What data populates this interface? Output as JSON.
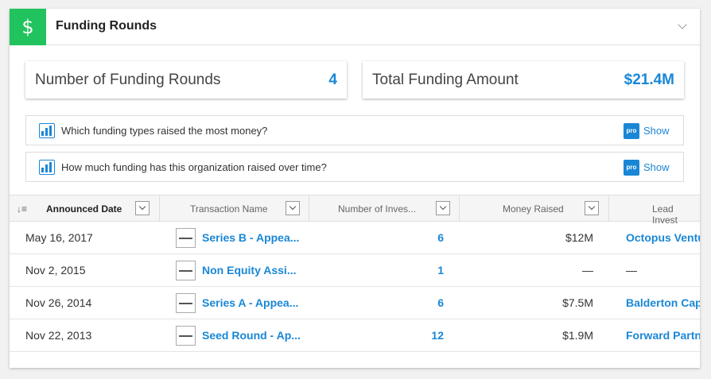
{
  "header": {
    "icon": "dollar-icon",
    "icon_glyph": "$",
    "title": "Funding Rounds"
  },
  "stats": {
    "rounds_label": "Number of Funding Rounds",
    "rounds_value": "4",
    "total_label": "Total Funding Amount",
    "total_value": "$21.4M"
  },
  "questions": [
    {
      "text": "Which funding types raised the most money?",
      "badge": "pro",
      "action": "Show"
    },
    {
      "text": "How much funding has this organization raised over time?",
      "badge": "pro",
      "action": "Show"
    }
  ],
  "table": {
    "columns": [
      "Announced Date",
      "Transaction Name",
      "Number of Inves...",
      "Money Raised",
      "Lead Invest"
    ],
    "rows": [
      {
        "date": "May 16, 2017",
        "name": "Series B - Appea...",
        "investors": "6",
        "money": "$12M",
        "lead": "Octopus Ventu"
      },
      {
        "date": "Nov 2, 2015",
        "name": "Non Equity Assi...",
        "investors": "1",
        "money": "—",
        "lead": "—"
      },
      {
        "date": "Nov 26, 2014",
        "name": "Series A - Appea...",
        "investors": "6",
        "money": "$7.5M",
        "lead": "Balderton Capi"
      },
      {
        "date": "Nov 22, 2013",
        "name": "Seed Round - Ap...",
        "investors": "12",
        "money": "$1.9M",
        "lead": "Forward Partne"
      }
    ]
  },
  "colors": {
    "accent": "#1a87d6",
    "header_icon_bg": "#21c35e"
  }
}
